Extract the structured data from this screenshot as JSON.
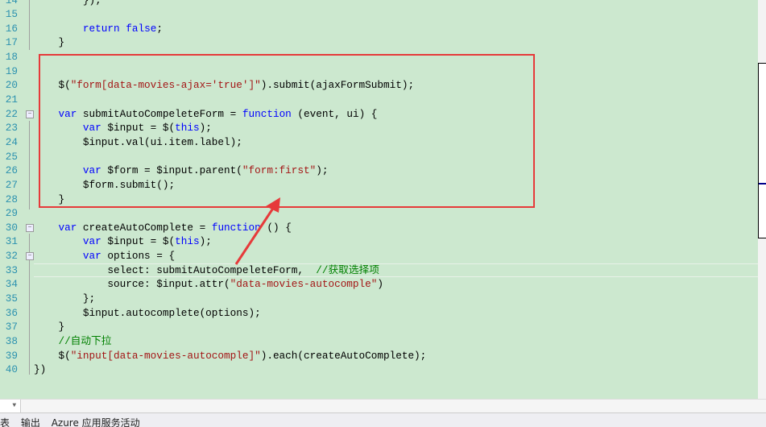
{
  "editor": {
    "background": "#cce8cf",
    "current_line": 33,
    "lines": [
      {
        "n": "14",
        "t": [
          [
            "pl",
            "        });"
          ]
        ]
      },
      {
        "n": "15",
        "t": []
      },
      {
        "n": "16",
        "t": [
          [
            "pl",
            "        "
          ],
          [
            "kw",
            "return"
          ],
          [
            "pl",
            " "
          ],
          [
            "kw",
            "false"
          ],
          [
            "pl",
            ";"
          ]
        ]
      },
      {
        "n": "17",
        "t": [
          [
            "pl",
            "    }"
          ]
        ]
      },
      {
        "n": "18",
        "t": []
      },
      {
        "n": "19",
        "t": []
      },
      {
        "n": "20",
        "t": [
          [
            "pl",
            "    $("
          ],
          [
            "str",
            "\"form[data-movies-ajax='true']\""
          ],
          [
            "pl",
            ").submit(ajaxFormSubmit);"
          ]
        ]
      },
      {
        "n": "21",
        "t": []
      },
      {
        "n": "22",
        "fold": true,
        "t": [
          [
            "pl",
            "    "
          ],
          [
            "kw",
            "var"
          ],
          [
            "pl",
            " submitAutoCompeleteForm = "
          ],
          [
            "kw",
            "function"
          ],
          [
            "pl",
            " (event, ui) {"
          ]
        ]
      },
      {
        "n": "23",
        "t": [
          [
            "pl",
            "        "
          ],
          [
            "kw",
            "var"
          ],
          [
            "pl",
            " $input = $("
          ],
          [
            "kw",
            "this"
          ],
          [
            "pl",
            ");"
          ]
        ]
      },
      {
        "n": "24",
        "t": [
          [
            "pl",
            "        $input.val(ui.item.label);"
          ]
        ]
      },
      {
        "n": "25",
        "t": []
      },
      {
        "n": "26",
        "t": [
          [
            "pl",
            "        "
          ],
          [
            "kw",
            "var"
          ],
          [
            "pl",
            " $form = $input.parent("
          ],
          [
            "str",
            "\"form:first\""
          ],
          [
            "pl",
            ");"
          ]
        ]
      },
      {
        "n": "27",
        "t": [
          [
            "pl",
            "        $form.submit();"
          ]
        ]
      },
      {
        "n": "28",
        "t": [
          [
            "pl",
            "    }"
          ]
        ]
      },
      {
        "n": "29",
        "t": []
      },
      {
        "n": "30",
        "fold": true,
        "t": [
          [
            "pl",
            "    "
          ],
          [
            "kw",
            "var"
          ],
          [
            "pl",
            " createAutoComplete = "
          ],
          [
            "kw",
            "function"
          ],
          [
            "pl",
            " () {"
          ]
        ]
      },
      {
        "n": "31",
        "t": [
          [
            "pl",
            "        "
          ],
          [
            "kw",
            "var"
          ],
          [
            "pl",
            " $input = $("
          ],
          [
            "kw",
            "this"
          ],
          [
            "pl",
            ");"
          ]
        ]
      },
      {
        "n": "32",
        "fold": true,
        "t": [
          [
            "pl",
            "        "
          ],
          [
            "kw",
            "var"
          ],
          [
            "pl",
            " options = {"
          ]
        ]
      },
      {
        "n": "33",
        "t": [
          [
            "pl",
            "            select: submitAutoCompeleteForm,  "
          ],
          [
            "cm",
            "//获取选择项"
          ]
        ]
      },
      {
        "n": "34",
        "t": [
          [
            "pl",
            "            source: $input.attr("
          ],
          [
            "str",
            "\"data-movies-autocomple\""
          ],
          [
            "pl",
            ")"
          ]
        ]
      },
      {
        "n": "35",
        "t": [
          [
            "pl",
            "        };"
          ]
        ]
      },
      {
        "n": "36",
        "t": [
          [
            "pl",
            "        $input.autocomplete(options);"
          ]
        ]
      },
      {
        "n": "37",
        "t": [
          [
            "pl",
            "    }"
          ]
        ]
      },
      {
        "n": "38",
        "t": [
          [
            "cm",
            "    //自动下拉"
          ]
        ]
      },
      {
        "n": "39",
        "t": [
          [
            "pl",
            "    $("
          ],
          [
            "str",
            "\"input[data-movies-autocomple]\""
          ],
          [
            "pl",
            ").each(createAutoComplete);"
          ]
        ]
      },
      {
        "n": "40",
        "t": [
          [
            "pl",
            "})"
          ]
        ]
      }
    ]
  },
  "annotation": {
    "color": "#e63a3a"
  },
  "bottom_tabs": [
    "表",
    "输出",
    "Azure 应用服务活动"
  ]
}
